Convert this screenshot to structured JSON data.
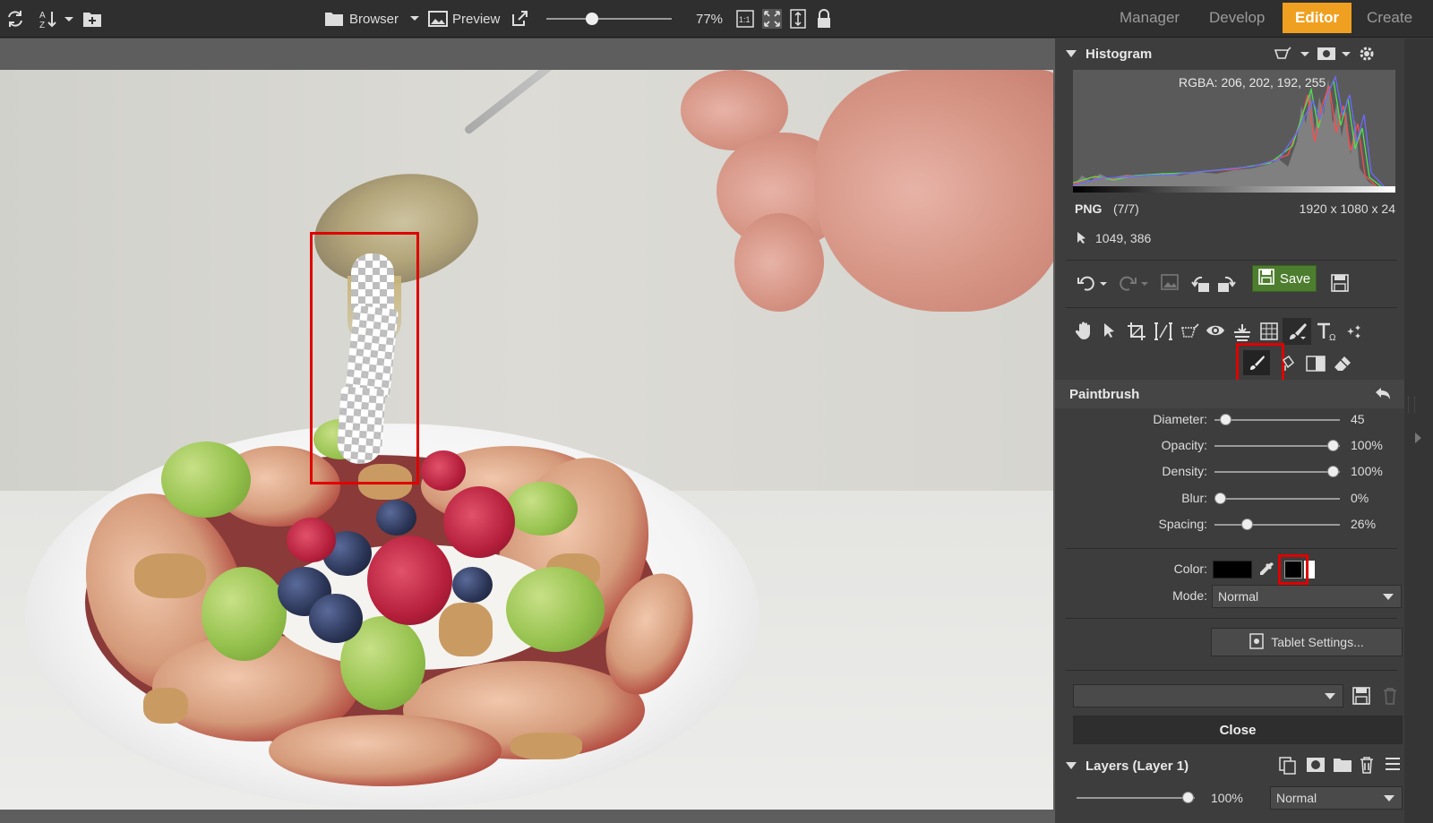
{
  "topbar": {
    "browser_label": "Browser",
    "preview_label": "Preview",
    "zoom": "77%",
    "zoom_fraction": 0.35,
    "one_to_one": "1:1",
    "modes": [
      "Manager",
      "Develop",
      "Editor",
      "Create"
    ],
    "active_mode": "Editor",
    "accent_color": "#f0a020"
  },
  "histogram": {
    "title": "Histogram",
    "rgba": "RGBA: 206, 202, 192, 255",
    "format": "PNG",
    "count": "(7/7)",
    "dimensions": "1920 x 1080 x 24",
    "cursor": "1049, 386"
  },
  "toolbar": {
    "save_label": "Save"
  },
  "paintbrush": {
    "title": "Paintbrush",
    "settings": [
      {
        "label": "Diameter:",
        "value": "45",
        "level": 0.05
      },
      {
        "label": "Opacity:",
        "value": "100%",
        "level": 1.0
      },
      {
        "label": "Density:",
        "value": "100%",
        "level": 1.0
      },
      {
        "label": "Blur:",
        "value": "0%",
        "level": 0.0
      },
      {
        "label": "Spacing:",
        "value": "26%",
        "level": 0.24
      }
    ],
    "color_label": "Color:",
    "mode_label": "Mode:",
    "mode_value": "Normal",
    "tablet_settings": "Tablet Settings...",
    "close_label": "Close"
  },
  "layers": {
    "title": "Layers (Layer 1)",
    "opacity": "100%",
    "opacity_level": 1.0,
    "blend_mode": "Normal"
  }
}
